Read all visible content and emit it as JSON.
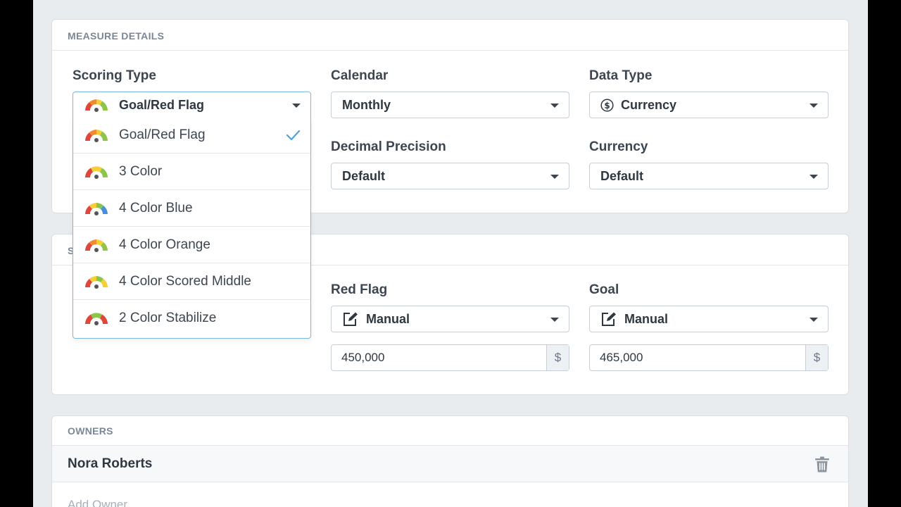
{
  "measure_details": {
    "header": "MEASURE DETAILS",
    "scoring_type": {
      "label": "Scoring Type",
      "value": "Goal/Red Flag"
    },
    "calendar": {
      "label": "Calendar",
      "value": "Monthly"
    },
    "data_type": {
      "label": "Data Type",
      "value": "Currency",
      "icon": "dollar-circle-icon"
    },
    "decimal_precision": {
      "label": "Decimal Precision",
      "value": "Default"
    },
    "currency": {
      "label": "Currency",
      "value": "Default"
    }
  },
  "scoring_dropdown": {
    "items": [
      {
        "label": "Goal/Red Flag",
        "selected": true,
        "gauge": "goal-red-flag"
      },
      {
        "label": "3 Color",
        "selected": false,
        "gauge": "3-color"
      },
      {
        "label": "4 Color Blue",
        "selected": false,
        "gauge": "4-color-blue"
      },
      {
        "label": "4 Color Orange",
        "selected": false,
        "gauge": "4-color-orange"
      },
      {
        "label": "4 Color Scored Middle",
        "selected": false,
        "gauge": "4-color-scored-middle"
      },
      {
        "label": "2 Color Stabilize",
        "selected": false,
        "gauge": "2-color-stabilize"
      }
    ]
  },
  "scoring_section": {
    "header_partial": "S",
    "red_flag": {
      "label": "Red Flag",
      "mode": "Manual",
      "value": "450,000",
      "addon": "$"
    },
    "goal": {
      "label": "Goal",
      "mode": "Manual",
      "value": "465,000",
      "addon": "$"
    }
  },
  "owners": {
    "header": "OWNERS",
    "list": [
      {
        "name": "Nora Roberts"
      }
    ],
    "add_placeholder": "Add Owner"
  },
  "colors": {
    "red": "#e0463a",
    "orange": "#f08a2c",
    "yellow": "#f5cf33",
    "green": "#8cc54a",
    "blue": "#4a90d9",
    "accent": "#4aa3df"
  }
}
